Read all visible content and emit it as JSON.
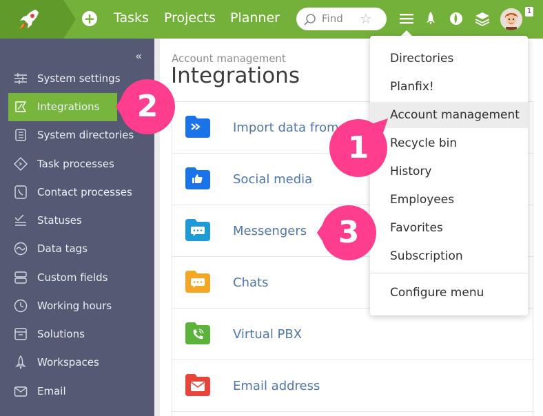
{
  "topbar": {
    "nav": [
      "Tasks",
      "Projects",
      "Planner"
    ],
    "search_placeholder": "Find",
    "notification_count": "1"
  },
  "sidebar": {
    "items": [
      {
        "label": "System settings",
        "icon": "sliders-icon"
      },
      {
        "label": "Integrations",
        "icon": "plug-icon",
        "active": true
      },
      {
        "label": "System directories",
        "icon": "book-icon"
      },
      {
        "label": "Task processes",
        "icon": "diamond-icon"
      },
      {
        "label": "Contact processes",
        "icon": "phone-icon"
      },
      {
        "label": "Statuses",
        "icon": "check-list-icon"
      },
      {
        "label": "Data tags",
        "icon": "wave-icon"
      },
      {
        "label": "Custom fields",
        "icon": "fields-icon"
      },
      {
        "label": "Working hours",
        "icon": "clock-icon"
      },
      {
        "label": "Solutions",
        "icon": "box-icon"
      },
      {
        "label": "Workspaces",
        "icon": "rocket-icon"
      },
      {
        "label": "Email",
        "icon": "envelope-icon"
      }
    ]
  },
  "main": {
    "breadcrumb": "Account management",
    "title": "Integrations",
    "rows": [
      {
        "label": "Import data from o",
        "icon": "import-folder-icon",
        "color": "#1a73e8"
      },
      {
        "label": "Social media",
        "icon": "thumbs-up-folder-icon",
        "color": "#1a73e8"
      },
      {
        "label": "Messengers",
        "icon": "chat-folder-icon",
        "color": "#1e9bd7"
      },
      {
        "label": "Chats",
        "icon": "chat-folder-icon",
        "color": "#f5a623"
      },
      {
        "label": "Virtual PBX",
        "icon": "phone-folder-icon",
        "color": "#5cb33a"
      },
      {
        "label": "Email address",
        "icon": "envelope-folder-icon",
        "color": "#e8443a"
      }
    ]
  },
  "dropdown": {
    "items": [
      "Directories",
      "Planfix!",
      "Account management",
      "Recycle bin",
      "History",
      "Employees",
      "Favorites",
      "Subscription"
    ],
    "highlighted": "Account management",
    "footer": "Configure menu"
  },
  "callouts": [
    "1",
    "2",
    "3"
  ],
  "colors": {
    "topbar": "#74b13b",
    "sidebar": "#545a74",
    "active": "#77b53d",
    "callout": "#ff3d8f",
    "link": "#4f77a8"
  }
}
